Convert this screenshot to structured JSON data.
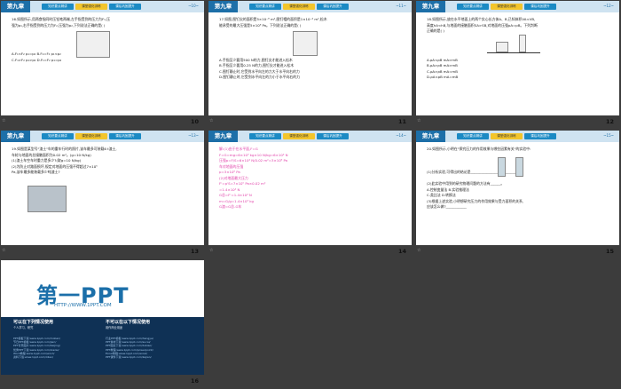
{
  "header": {
    "chapter": "第九章",
    "tabs": [
      "知识要点精讲",
      "课堂强化训练",
      "课后巩固提升"
    ]
  },
  "slides": [
    {
      "number": "10",
      "page_tag": "~10~",
      "active_tab": 1,
      "lines": [
        "16.如图所示,用两食指同时压铅笔两端,左手指受到的压力为F₁,压",
        "强为p₁,右手指受到的压力为F₂,压强为p₂,下列说法正确的是(    )",
        "",
        "",
        "",
        "",
        "A.F₁<F₂   p₁=p₂     B.F₁=F₂   p₁<p₂",
        "C.F₁>F₂   p₁>p₂     D.F₁=F₂   p₁=p₂"
      ]
    },
    {
      "number": "11",
      "page_tag": "~11~",
      "active_tab": 1,
      "lines": [
        "17.如图,图钉尖的面积是5×10⁻⁸ m²,图钉帽的面积是1×10⁻⁴ m²,松木",
        "能承受的最大压强是5×10⁶ Pa。下列说法正确的是(    )",
        "",
        "",
        "",
        "",
        "",
        "A.手指至少要用500 N的力,图钉尖才能进入松木",
        "B.手指至少要用0.25 N的力,图钉尖才能进入松木",
        "C.图钉静止时,它受到水平向左的力大于水平向右的力",
        "D.图钉静止时,它受到水平向左的力小于水平向右的力"
      ]
    },
    {
      "number": "12",
      "page_tag": "~12~",
      "active_tab": 1,
      "lines": [
        "18.如图所示,放在水平地面上的两个实心长方体A、B,已知体积VA<VB,",
        "高度hA<hB,与地面的接触面积SA>SB,对地面的压强pA=pB。下列判断",
        "正确的是(    )",
        "",
        "",
        "",
        "",
        "A.ρA<ρB   mA>mB",
        "B.ρA>ρB   mA>mB",
        "C.ρA>ρB   mA=mB",
        "D.ρA<ρB   mA=mB"
      ]
    },
    {
      "number": "13",
      "page_tag": "~13~",
      "active_tab": 1,
      "lines": [
        "19.如图是某型号\"渣土\"车的重车行时的照片,该车最多可装载6 t渣土,",
        "车轮与地面的总接触面积为0.02 m²。(g=10 N/kg)",
        "(1)渣土车空车时重力是多少?(取g=10 N/kg)",
        "(2)为防止对路面损坏,规定对地面的压强不得超过7×10⁵",
        "Pa,该车最多能装载多少吨渣土?"
      ]
    },
    {
      "number": "14",
      "page_tag": "~14~",
      "active_tab": 1,
      "lines": [
        "解:(1)由于在水平面,F=G",
        "F=G=mg=6×10³ kg×10 N/kg=6×10⁴ N",
        "压强p=F/S=6×10⁴ N/0.02 m²=3×10⁶ Pa",
        "车对地面的压强",
        "p=3×10⁶ Pa",
        "(2)对地面最大压力",
        "F'=p'S=7×10⁵ Pa×0.02 m²",
        "=1.4×10⁴ N",
        "G总=F'=1.4×10⁴ N",
        "m=G/g=1.4×10³ kg",
        "G渣=G总-G车"
      ]
    },
    {
      "number": "15",
      "page_tag": "~15~",
      "active_tab": 1,
      "lines": [
        "20.如图所示,小明在\"探究压力的作用效果与哪些因素有关\"的实验中:",
        "",
        "",
        "",
        "(1)分析实验,可得出的结论是___________________________",
        "",
        "(2)此实验中用到的研究物理问题的方法有______。",
        "A.控制变量法      B.实验推理法",
        "C.类比法          D.转换法",
        "(3)根据上述实验,小明想研究压力的作用效果与受力面积的关系,",
        "应该怎么做?____________"
      ]
    }
  ],
  "ad": {
    "number": "16",
    "logo": "第一PPT",
    "url": "HTTP://WWW.1PPT.COM",
    "can_title": "可以在下列情况使用",
    "can_sub": "个人学习、研究",
    "cannot_title": "不可以在以下情况使用",
    "cannot_sub": "用作商业用途",
    "links_left": [
      "PPT模板下载:www.1ppt.com/moban/",
      "节日PPT模板:www.1ppt.com/jieri/",
      "PPT背景图片:www.1ppt.com/beijing/",
      "优秀PPT下载:www.1ppt.com/xiazai/",
      "Word教程:www.1ppt.com/word/",
      "资料下载:www.1ppt.com/ziliao/"
    ],
    "links_right": [
      "行业PPT模板:www.1ppt.com/hangye/",
      "PPT素材下载:www.1ppt.com/sucai/",
      "PPT图表下载:www.1ppt.com/tubiao/",
      "PPT教程:www.1ppt.com/powerpoint/",
      "Excel教程:www.1ppt.com/excel/",
      "PPT课件下载:www.1ppt.com/kejian/"
    ]
  },
  "colors": {
    "header": "#1d6fa8",
    "tab": "#1b8ac4",
    "tab_active": "#f3c52b",
    "answer": "#e03ea8",
    "ad_band": "#0f3155"
  }
}
